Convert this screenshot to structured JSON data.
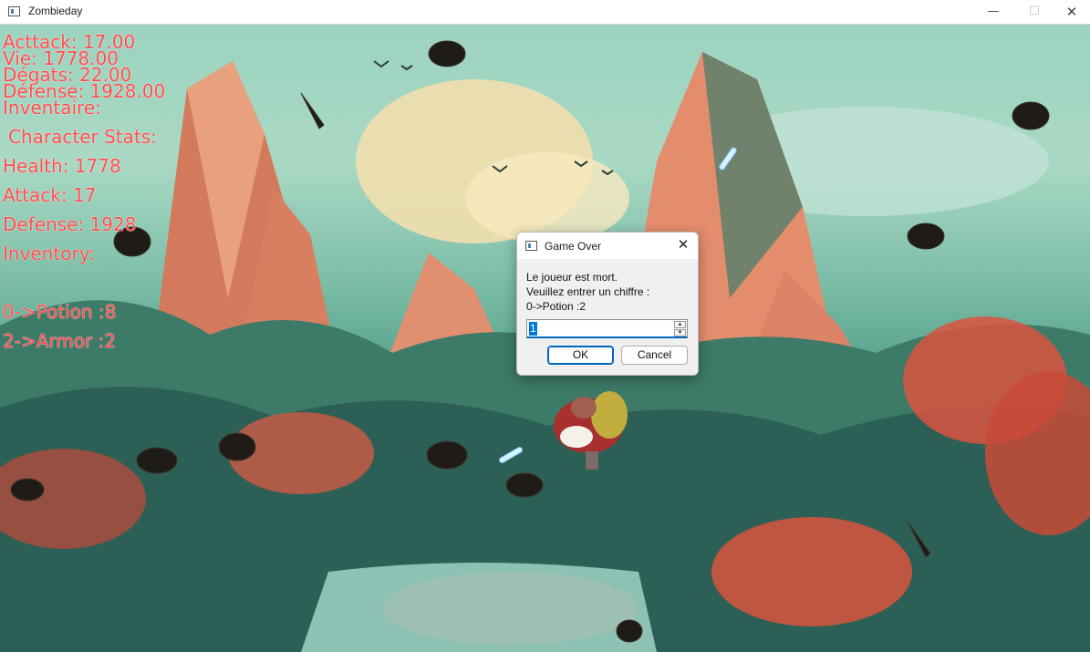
{
  "window": {
    "title": "Zombieday",
    "controls": {
      "minimize": "—",
      "maximize": "☐",
      "close": "✕"
    }
  },
  "hud": {
    "attack": "Acttack: 17.00",
    "life": "Vie: 1778.00",
    "damage": "Dégats: 22.00",
    "defense": "Défense: 1928.00",
    "inventory_fr": "Inventaire:",
    "stats_header": "Character Stats:",
    "health": "Health: 1778",
    "attack_en": "Attack: 17",
    "defense_en": "Defense: 1928",
    "inventory_en": "Inventory:",
    "items": [
      "0->Potion :8",
      "2->Armor :2"
    ]
  },
  "dialog": {
    "title": "Game Over",
    "lines": [
      "Le joueur est mort.",
      "Veuillez entrer un chiffre :",
      "0->Potion :2"
    ],
    "input_value": "1",
    "ok_label": "OK",
    "cancel_label": "Cancel"
  },
  "colors": {
    "hud_text": "#ff4b4b",
    "accent": "#0067c0"
  },
  "icons": {
    "window": "app-window-icon",
    "dialog": "dialog-window-icon",
    "close": "close-icon"
  }
}
